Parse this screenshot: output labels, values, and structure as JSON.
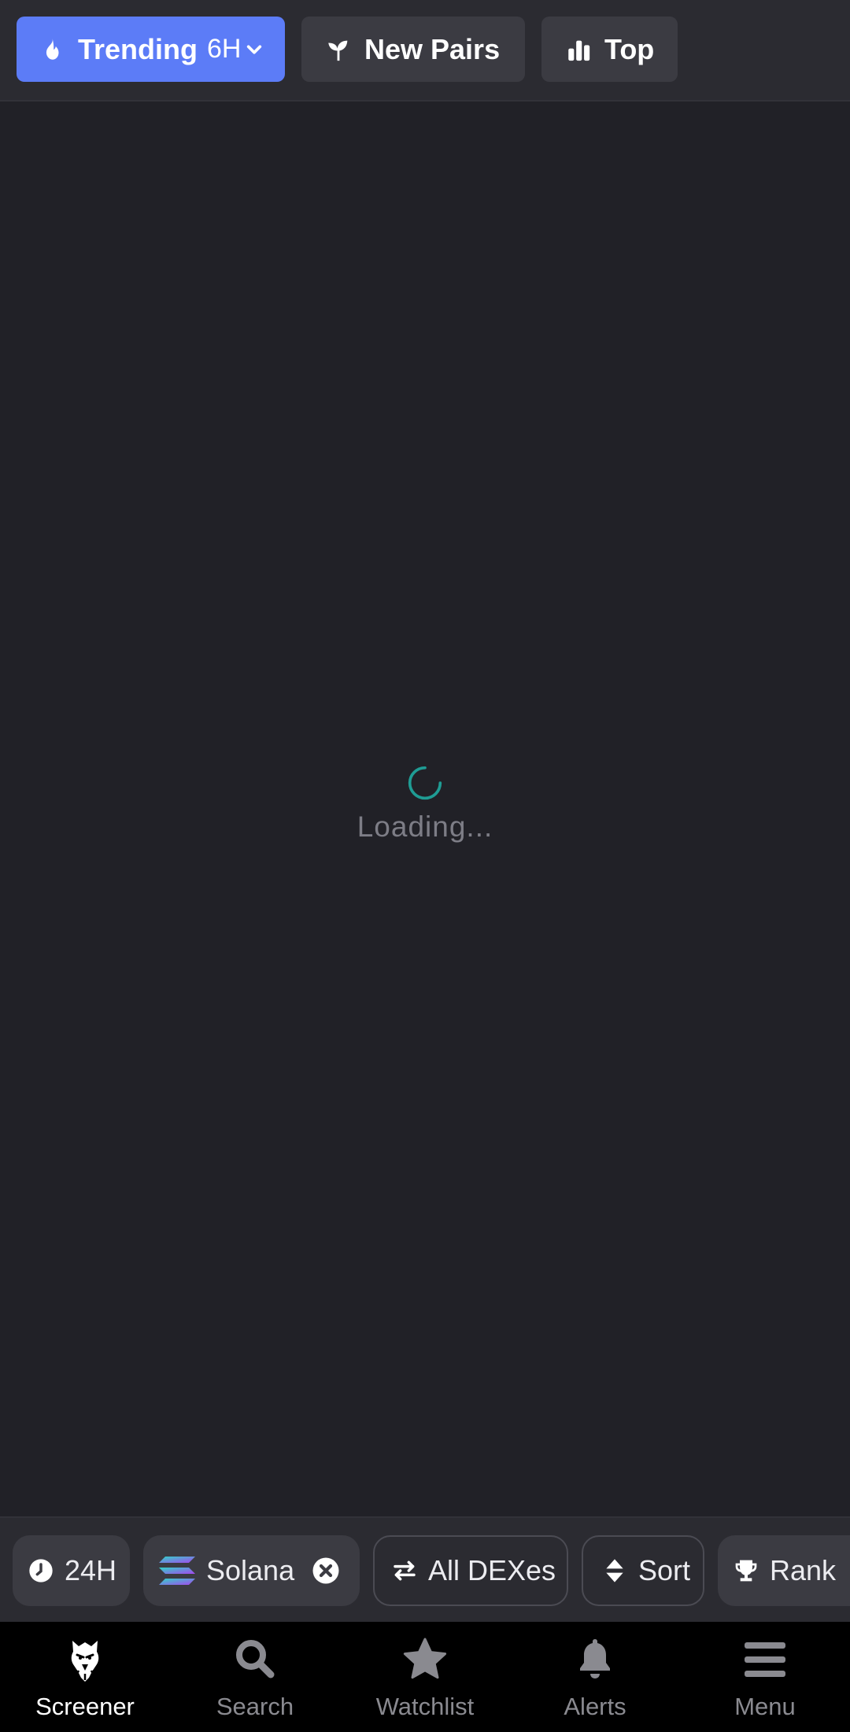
{
  "tabs": {
    "trending": {
      "label": "Trending",
      "period": "6H",
      "icon": "flame-icon",
      "active": true
    },
    "new_pairs": {
      "label": "New Pairs",
      "icon": "sprout-icon"
    },
    "top": {
      "label": "Top",
      "icon": "bar-chart-icon"
    }
  },
  "loading": {
    "text": "Loading..."
  },
  "filters": {
    "timeframe": {
      "label": "24H",
      "icon": "clock-icon"
    },
    "chain": {
      "label": "Solana",
      "icon": "solana-logo-icon",
      "remove_icon": "close-circle-icon"
    },
    "dexes": {
      "label": "All DEXes",
      "icon": "swap-arrows-icon"
    },
    "sort": {
      "label": "Sort",
      "icon": "sort-icon"
    },
    "rank": {
      "label": "Rank",
      "icon": "trophy-icon"
    }
  },
  "nav": [
    {
      "label": "Screener",
      "icon": "eagle-icon",
      "active": true
    },
    {
      "label": "Search",
      "icon": "search-icon"
    },
    {
      "label": "Watchlist",
      "icon": "star-icon"
    },
    {
      "label": "Alerts",
      "icon": "bell-icon"
    },
    {
      "label": "Menu",
      "icon": "menu-icon"
    }
  ],
  "colors": {
    "background": "#212127",
    "accent": "#5c7cf7",
    "spinner": "#1f9c94",
    "muted_text": "#7d7d86"
  }
}
